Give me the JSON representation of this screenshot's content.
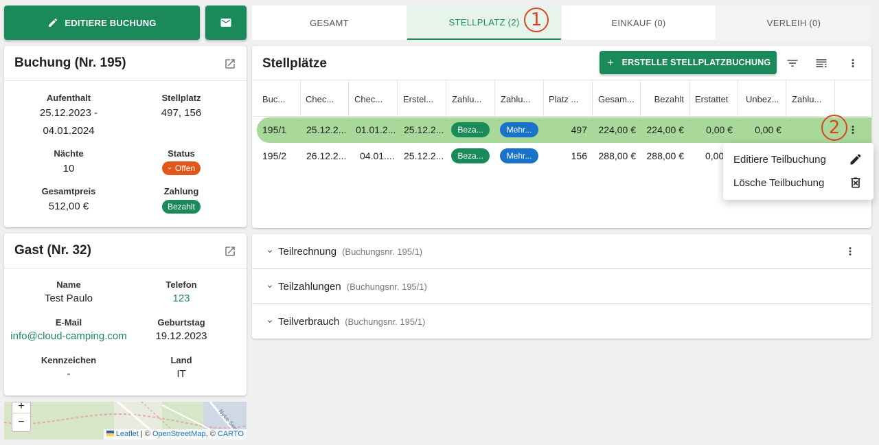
{
  "colors": {
    "primary": "#1b8a5a",
    "status_open": "#e2571e",
    "payment_paid": "#1b8a5a",
    "payment_more": "#1a73c8",
    "row_highlight": "#a8d89a",
    "annotation": "#e0421f"
  },
  "toolbar": {
    "edit_booking_label": "EDITIERE BUCHUNG",
    "edit_icon": "pencil-icon",
    "mail_icon": "mail-icon"
  },
  "tabs": [
    {
      "label": "GESAMT",
      "active": false
    },
    {
      "label": "STELLPLATZ (2)",
      "active": true
    },
    {
      "label": "EINKAUF (0)",
      "active": false
    },
    {
      "label": "VERLEIH (0)",
      "active": false
    }
  ],
  "annotations": {
    "one": "1",
    "two": "2"
  },
  "booking": {
    "title": "Buchung (Nr. 195)",
    "stay_label": "Aufenthalt",
    "stay_value": "25.12.2023 - 04.01.2024",
    "pitch_label": "Stellplatz",
    "pitch_value": "497, 156",
    "nights_label": "Nächte",
    "nights_value": "10",
    "status_label": "Status",
    "status_value": "Offen",
    "total_label": "Gesamtpreis",
    "total_value": "512,00 €",
    "payment_label": "Zahlung",
    "payment_value": "Bezahlt"
  },
  "guest": {
    "title": "Gast (Nr. 32)",
    "name_label": "Name",
    "name_value": "Test Paulo",
    "phone_label": "Telefon",
    "phone_value": "123",
    "email_label": "E-Mail",
    "email_value": "info@cloud-camping.com",
    "birthday_label": "Geburtstag",
    "birthday_value": "19.12.2023",
    "plate_label": "Kennzeichen",
    "plate_value": "-",
    "country_label": "Land",
    "country_value": "IT"
  },
  "map": {
    "zoom_in": "+",
    "zoom_out": "−",
    "attr_leaflet": "Leaflet",
    "attr_sep1": " | © ",
    "attr_osm": "OpenStreetMap",
    "attr_sep2": ", © ",
    "attr_carto": "CARTO",
    "street": "Nyke Senn"
  },
  "pitches": {
    "title": "Stellplätze",
    "create_label": "ERSTELLE STELLPLATZBUCHUNG",
    "columns": [
      "Buc...",
      "Chec...",
      "Chec...",
      "Erstel...",
      "Zahlu...",
      "Zahlu...",
      "Platz ...",
      "Gesam...",
      "Bezahlt",
      "Erstattet",
      "Unbez...",
      "Zahlu..."
    ],
    "rows": [
      {
        "id": "195/1",
        "checkin": "25.12.2...",
        "checkout": "01.01.2...",
        "created": "25.12.2...",
        "pay_status": "Beza...",
        "pay_method": "Mehr...",
        "pitch": "497",
        "total": "224,00 €",
        "paid": "224,00 €",
        "refunded": "0,00 €",
        "unpaid": "0,00 €"
      },
      {
        "id": "195/2",
        "checkin": "26.12.2...",
        "checkout": "04.01....",
        "created": "25.12.2...",
        "pay_status": "Beza...",
        "pay_method": "Mehr...",
        "pitch": "156",
        "total": "288,00 €",
        "paid": "288,00 €",
        "refunded": "0,00",
        "unpaid": ""
      }
    ]
  },
  "context_menu": [
    {
      "label": "Editiere Teilbuchung",
      "icon": "pencil-icon"
    },
    {
      "label": "Lösche Teilbuchung",
      "icon": "trash-icon"
    }
  ],
  "sections": [
    {
      "title": "Teilrechnung",
      "subtitle": "(Buchungsnr. 195/1)"
    },
    {
      "title": "Teilzahlungen",
      "subtitle": "(Buchungsnr. 195/1)"
    },
    {
      "title": "Teilverbrauch",
      "subtitle": "(Buchungsnr. 195/1)"
    }
  ]
}
